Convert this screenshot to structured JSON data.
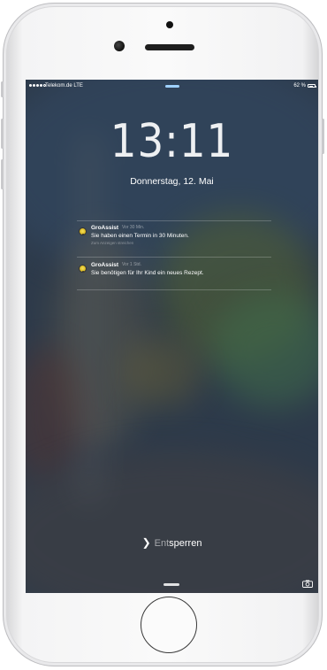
{
  "status_bar": {
    "carrier": "Telekom.de  LTE",
    "battery_text": "62 %",
    "battery_level": 0.62
  },
  "lock_screen": {
    "time": "13:11",
    "date": "Donnerstag, 12. Mai",
    "unlock_label_start": "Ent",
    "unlock_label_end": "sperren"
  },
  "notifications": [
    {
      "app": "GroAssist",
      "time": "Vor 30 Min.",
      "message": "Sie haben einen Termin in 30 Minuten.",
      "hint": "Zum Anzeigen streichen"
    },
    {
      "app": "GroAssist",
      "time": "Vor 1 Std.",
      "message": "Sie benötigen für Ihr Kind ein neues Rezept."
    }
  ],
  "icons": {
    "app_icon": "groassist-app-icon",
    "camera": "camera-icon",
    "unlock_chevron": "chevron-right-icon"
  },
  "colors": {
    "wallpaper_base": "#2d3a4a",
    "top_handle": "#9fd1ff"
  }
}
